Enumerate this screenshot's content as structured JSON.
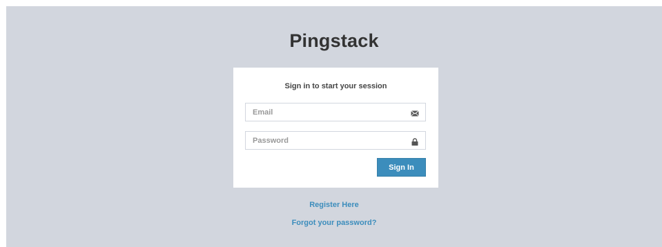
{
  "app": {
    "brand": "Pingstack"
  },
  "login": {
    "message": "Sign in to start your session",
    "email": {
      "placeholder": "Email",
      "value": "",
      "icon": "envelope-icon"
    },
    "password": {
      "placeholder": "Password",
      "value": "",
      "icon": "lock-icon"
    },
    "submit_label": "Sign In"
  },
  "links": {
    "register": "Register Here",
    "forgot": "Forgot your password?"
  },
  "colors": {
    "background": "#d2d6de",
    "accent": "#3c8dbc",
    "text": "#333333"
  }
}
